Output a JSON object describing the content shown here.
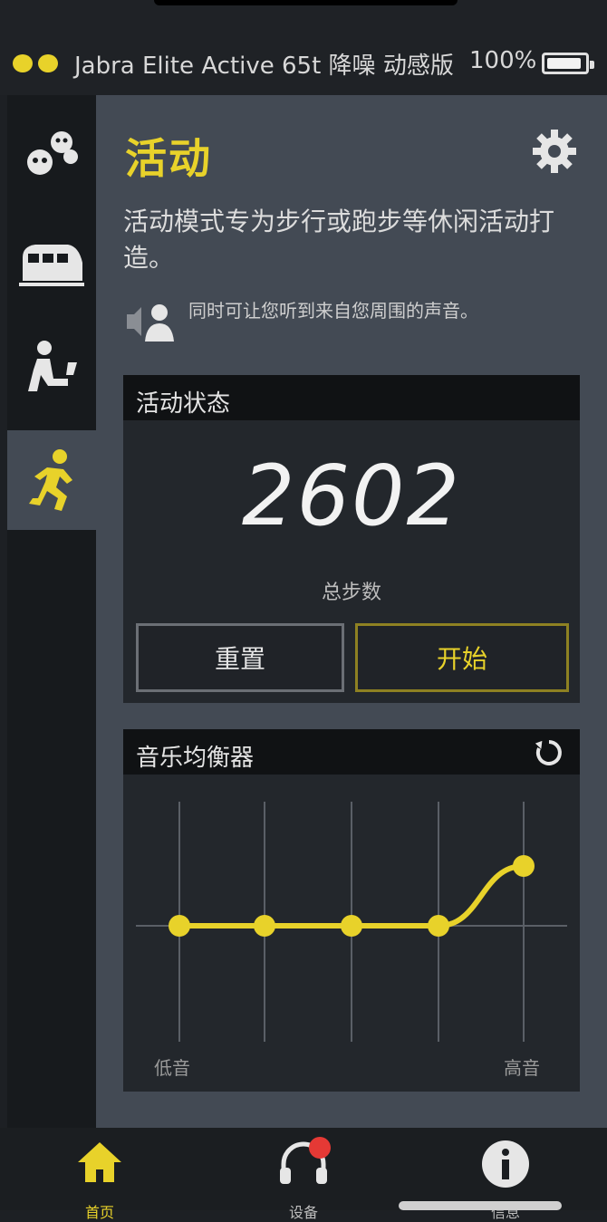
{
  "colors": {
    "accent": "#e8d22a",
    "panel": "#434a54",
    "card": "#23272c",
    "badge": "#e53935"
  },
  "header": {
    "device_name": "Jabra Elite Active 65t 降噪 动感版",
    "battery_percent": "100%",
    "battery_level": 1.0
  },
  "sidebar": {
    "items": [
      {
        "icon": "people-group-icon",
        "active": false
      },
      {
        "icon": "train-icon",
        "active": false
      },
      {
        "icon": "person-sitting-icon",
        "active": false
      },
      {
        "icon": "runner-icon",
        "active": true
      }
    ]
  },
  "main": {
    "title": "活动",
    "description": "活动模式专为步行或跑步等休闲活动打造。",
    "hearthrough_text": "同时可让您听到来自您周围的声音。"
  },
  "step_card": {
    "header": "活动状态",
    "count": "2602",
    "count_label": "总步数",
    "reset_label": "重置",
    "start_label": "开始"
  },
  "equalizer": {
    "header": "音乐均衡器",
    "low_label": "低音",
    "high_label": "高音",
    "bands": [
      0,
      0,
      0,
      0,
      0.6
    ]
  },
  "bottom_nav": {
    "items": [
      {
        "label": "首页",
        "icon": "home-icon",
        "active": true
      },
      {
        "label": "设备",
        "icon": "headphones-icon",
        "active": false,
        "badge": true
      },
      {
        "label": "信息",
        "icon": "info-icon",
        "active": false
      }
    ]
  }
}
